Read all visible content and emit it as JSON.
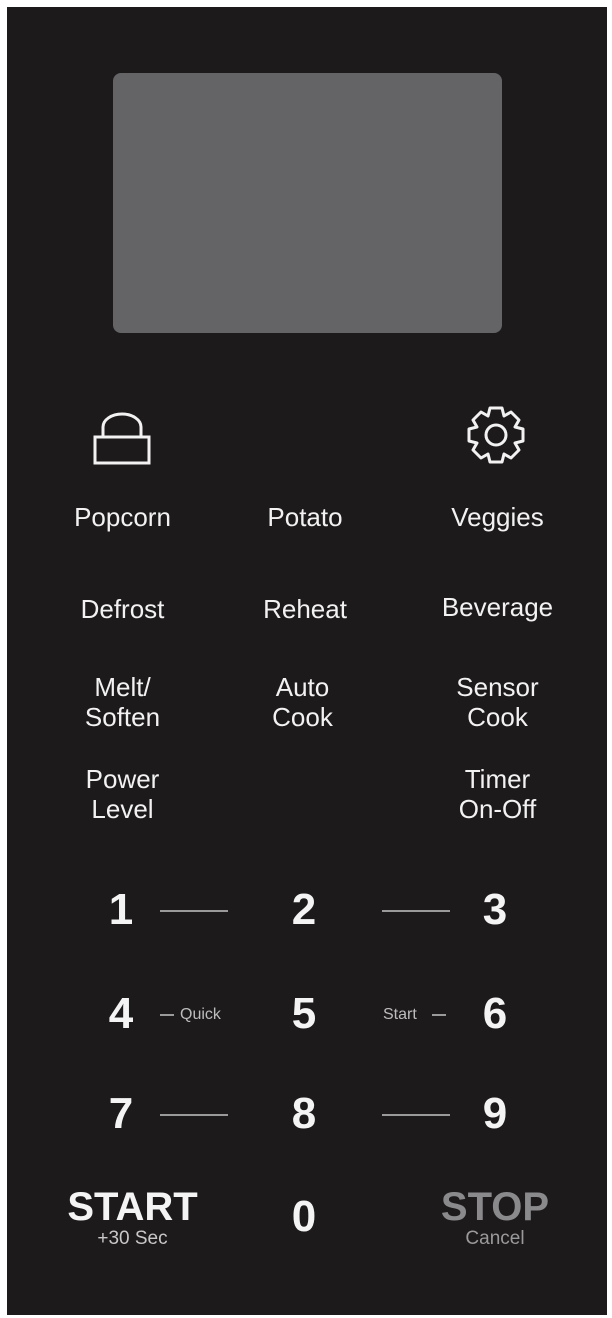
{
  "colors": {
    "panel": "#1d1a1b",
    "display": "#646467",
    "text": "#f2f2f2",
    "stop": "#8a8a8c"
  },
  "icons": {
    "lock": "lock-icon",
    "settings": "gear-icon"
  },
  "buttons": {
    "popcorn": "Popcorn",
    "potato": "Potato",
    "veggies": "Veggies",
    "defrost": "Defrost",
    "reheat": "Reheat",
    "beverage": "Beverage",
    "melt_soften": [
      "Melt/",
      "Soften"
    ],
    "auto_cook": [
      "Auto",
      "Cook"
    ],
    "sensor_cook": [
      "Sensor",
      "Cook"
    ],
    "power_level": [
      "Power",
      "Level"
    ],
    "timer": [
      "Timer",
      "On-Off"
    ]
  },
  "keypad": {
    "digits": [
      "1",
      "2",
      "3",
      "4",
      "5",
      "6",
      "7",
      "8",
      "9",
      "0"
    ],
    "quick_label": "Quick",
    "start_label": "Start"
  },
  "start": {
    "label": "START",
    "sub": "+30 Sec"
  },
  "stop": {
    "label": "STOP",
    "sub": "Cancel"
  }
}
